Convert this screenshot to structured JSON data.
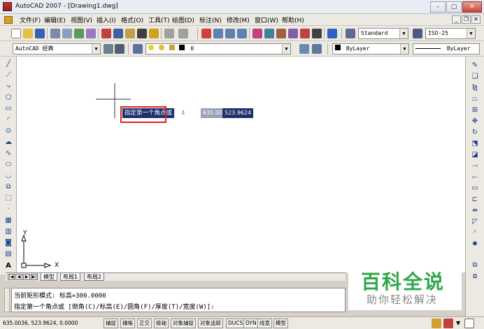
{
  "window": {
    "title": "AutoCAD 2007 - [Drawing1.dwg]",
    "min": "–",
    "max": "▢",
    "close": "✕"
  },
  "menu": {
    "items": [
      "文件(F)",
      "编辑(E)",
      "视图(V)",
      "插入(I)",
      "格式(O)",
      "工具(T)",
      "绘图(D)",
      "标注(N)",
      "修改(M)",
      "窗口(W)",
      "帮助(H)"
    ],
    "doc_min": "_",
    "doc_restore": "❐",
    "doc_close": "✕"
  },
  "toolbar1": {
    "text_style": "Standard",
    "dim_style": "ISO-25"
  },
  "toolbar2": {
    "workspace": "AutoCAD 经典",
    "layer": "0",
    "color": "ByLayer",
    "linetype": "ByLayer"
  },
  "canvas": {
    "ucs_y": "Y",
    "ucs_x": "X",
    "dyn_prompt": "指定第一个角点或",
    "dyn_down": "⇩",
    "dyn_x": "635.0036",
    "dyn_y": "523.9624"
  },
  "tabs": {
    "nav": [
      "|◀",
      "◀",
      "▶",
      "▶|"
    ],
    "items": [
      "模型",
      "布局1",
      "布局2"
    ]
  },
  "command": {
    "line1": "当前矩形模式:  标高=300.0000",
    "line2": "指定第一个角点或 [倒角(C)/标高(E)/圆角(F)/厚度(T)/宽度(W)]:"
  },
  "status": {
    "coords": "635.0036,  523.9624, 0.0000",
    "buttons": [
      "捕捉",
      "栅格",
      "正交",
      "极轴",
      "对象捕捉",
      "对象追踪",
      "DUCS",
      "DYN",
      "线宽",
      "模型"
    ]
  },
  "watermark": {
    "title": "百科全说",
    "subtitle": "助你轻松解决"
  },
  "colors": {
    "dyn_bg": "#1e2f6e",
    "highlight": "#e0201c",
    "watermark": "#2fa84a"
  }
}
